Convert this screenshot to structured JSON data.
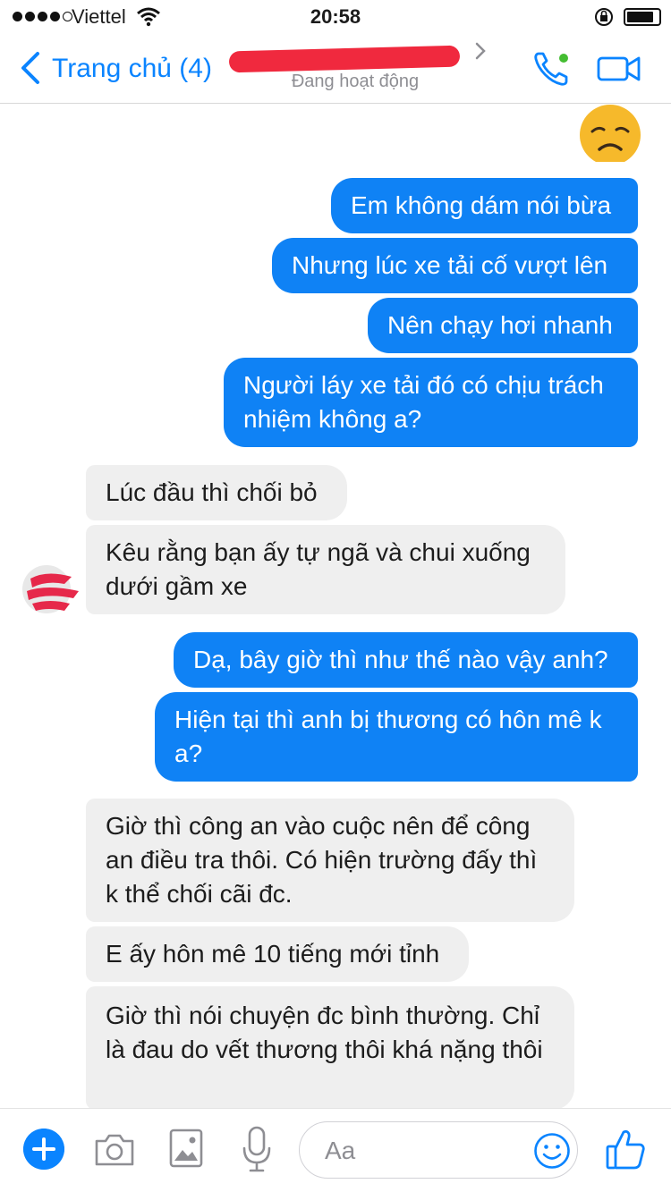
{
  "status_bar": {
    "carrier": "Viettel",
    "time": "20:58"
  },
  "nav": {
    "back_label": "Trang chủ (4)",
    "contact_name": "",
    "contact_status": "Đang hoạt động"
  },
  "messages": [
    {
      "dir": "out",
      "text": "Em không dám nói bừa"
    },
    {
      "dir": "out",
      "text": "Nhưng lúc xe tải cố vượt lên"
    },
    {
      "dir": "out",
      "text": "Nên chạy hơi nhanh"
    },
    {
      "dir": "out",
      "text": "Người láy xe tải đó có chịu trách nhiệm không a?"
    },
    {
      "dir": "in",
      "text": "Lúc đầu thì chối bỏ"
    },
    {
      "dir": "in",
      "text": "Kêu rằng bạn ấy tự ngã và chui xuống dưới gầm xe"
    },
    {
      "dir": "out",
      "text": "Dạ, bây giờ thì như thế nào vậy anh?"
    },
    {
      "dir": "out",
      "text": "Hiện tại thì anh bị thương có hôn mê k a?"
    },
    {
      "dir": "in",
      "text": "Giờ thì công an vào cuộc nên để công an điều tra thôi. Có hiện trường đấy thì k thể chối cãi đc."
    },
    {
      "dir": "in",
      "text": "E ấy hôn mê 10 tiếng mới tỉnh"
    },
    {
      "dir": "in",
      "text": "Giờ thì nói chuyện đc bình thường. Chỉ là đau do vết thương thôi khá nặng thôi"
    }
  ],
  "composer": {
    "placeholder": "Aa"
  },
  "colors": {
    "accent": "#0a84ff",
    "outgoing_bubble": "#0f82f5",
    "incoming_bubble": "#efefef",
    "online_dot": "#44bd32"
  }
}
